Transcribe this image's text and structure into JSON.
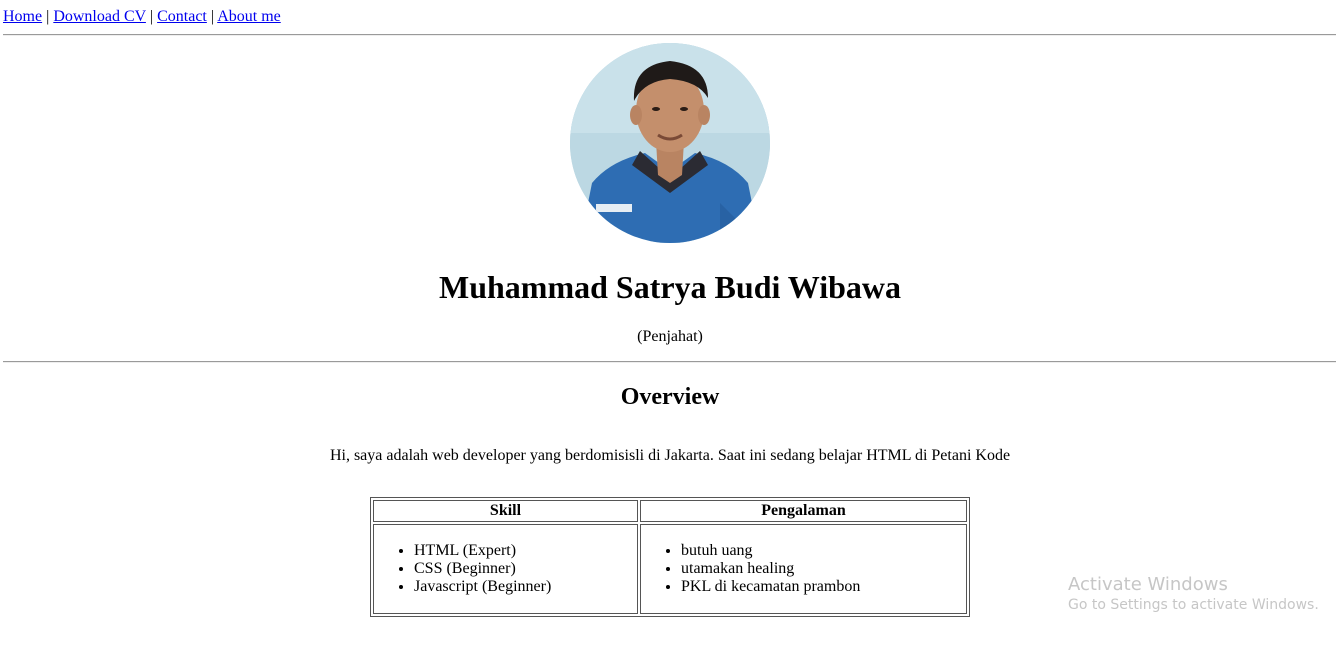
{
  "nav": {
    "items": [
      {
        "label": "Home"
      },
      {
        "label": "Download CV"
      },
      {
        "label": "Contact"
      },
      {
        "label": "About me"
      }
    ],
    "separator": "|"
  },
  "profile": {
    "name": "Muhammad Satrya Budi Wibawa",
    "nickname": "(Penjahat)"
  },
  "overview": {
    "heading": "Overview",
    "text": "Hi, saya adalah web developer yang berdomisisli di Jakarta. Saat ini sedang belajar HTML di Petani Kode"
  },
  "table": {
    "headers": [
      "Skill",
      "Pengalaman"
    ],
    "skills": [
      "HTML (Expert)",
      "CSS (Beginner)",
      "Javascript (Beginner)"
    ],
    "experience": [
      "butuh uang",
      "utamakan healing",
      "PKL di kecamatan prambon"
    ]
  },
  "watermark": {
    "title": "Activate Windows",
    "subtitle": "Go to Settings to activate Windows."
  },
  "colors": {
    "link": "#0000ee",
    "rule": "#9a9a9a",
    "watermark": "#c6c6c6"
  }
}
